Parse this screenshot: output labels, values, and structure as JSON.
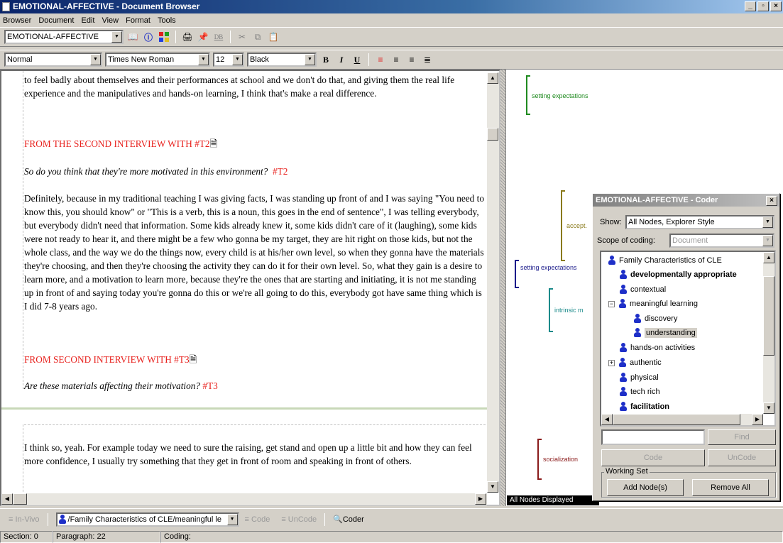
{
  "window": {
    "title": "EMOTIONAL-AFFECTIVE - Document Browser"
  },
  "menu": [
    "Browser",
    "Document",
    "Edit",
    "View",
    "Format",
    "Tools"
  ],
  "toolbar1": {
    "doc_combo": "EMOTIONAL-AFFECTIVE",
    "db_label": "DB"
  },
  "toolbar2": {
    "style": "Normal",
    "font": "Times New Roman",
    "size": "12",
    "color": "Black",
    "bold": "B",
    "italic": "I",
    "underline": "U"
  },
  "document": {
    "para1": "to feel badly about themselves and their performances at school and we don't do that, and giving them the real life experience and the manipulatives and hands-on learning, I think that's make a real difference.",
    "heading1": "FROM THE SECOND INTERVIEW WITH #T2",
    "question1": "So do you think that they're more motivated in this environment?",
    "question1_tag": "#T2",
    "para2": "Definitely, because in my traditional teaching I was giving facts, I was standing up front of and I was saying \"You need to know this, you should know\" or \"This is a verb, this is a noun, this goes in the end of sentence\", I was telling everybody, but everybody didn't need that information. Some kids already knew it, some kids didn't care of it (laughing), some kids were not ready to hear it, and there might be a few who gonna be my target, they are hit right on those kids, but not the whole class, and the way we do the things now, every child is at his/her own level, so when they gonna have the materials they're choosing, and then they're choosing the activity they can do it for their own level. So, what they gain is a desire to learn more, and a motivation to learn more, because they're the ones that are starting and initiating, it is not me standing up in front of and saying today you're gonna do this or we're all going to do this, everybody got have same thing which is I did 7-8 years ago.",
    "heading2": "FROM SECOND INTERVIEW WITH #T3",
    "question2": "Are these materials affecting their motivation?",
    "question2_tag": "#T3",
    "para3": "I think so, yeah. For example today we need to sure the raising, get stand and open up a little bit and how they can feel more confidence, I usually try something that they get in front of room and speaking in front of others."
  },
  "coding_stripes": {
    "s1": "setting expectations",
    "s2": "accept.",
    "s3": "setting expectations",
    "s4": "intrinsic m",
    "s5": "socialization",
    "footer": "All Nodes Displayed",
    "colors": {
      "green": "#1f8a1f",
      "olive": "#8a7a1a",
      "navy": "#1a1a8a",
      "teal": "#1a8a8a",
      "darkred": "#8a1a1a"
    }
  },
  "coder": {
    "title": "EMOTIONAL-AFFECTIVE - Coder",
    "show_label": "Show:",
    "show_value": "All Nodes, Explorer Style",
    "scope_label": "Scope of coding:",
    "scope_value": "Document",
    "tree": [
      {
        "label": "Family Characteristics of CLE",
        "bold": false
      },
      {
        "label": "developmentally appropriate",
        "bold": true
      },
      {
        "label": "contextual",
        "bold": false
      },
      {
        "label": "meaningful learning",
        "bold": false
      },
      {
        "label": "discovery",
        "bold": false
      },
      {
        "label": "understanding",
        "bold": false
      },
      {
        "label": "hands-on activities",
        "bold": false
      },
      {
        "label": "authentic",
        "bold": false
      },
      {
        "label": "physical",
        "bold": false
      },
      {
        "label": "tech rich",
        "bold": false
      },
      {
        "label": "facilitation",
        "bold": true
      }
    ],
    "find": "Find",
    "code": "Code",
    "uncode": "UnCode",
    "working_set": "Working Set",
    "add_nodes": "Add Node(s)",
    "remove_all": "Remove All"
  },
  "bottom": {
    "invivo": "In-Vivo",
    "node_path": "/Family Characteristics of CLE/meaningful le",
    "code": "Code",
    "uncode": "UnCode",
    "coder": "Coder"
  },
  "status": {
    "section": "Section: 0",
    "paragraph": "Paragraph: 22",
    "coding": "Coding:"
  }
}
